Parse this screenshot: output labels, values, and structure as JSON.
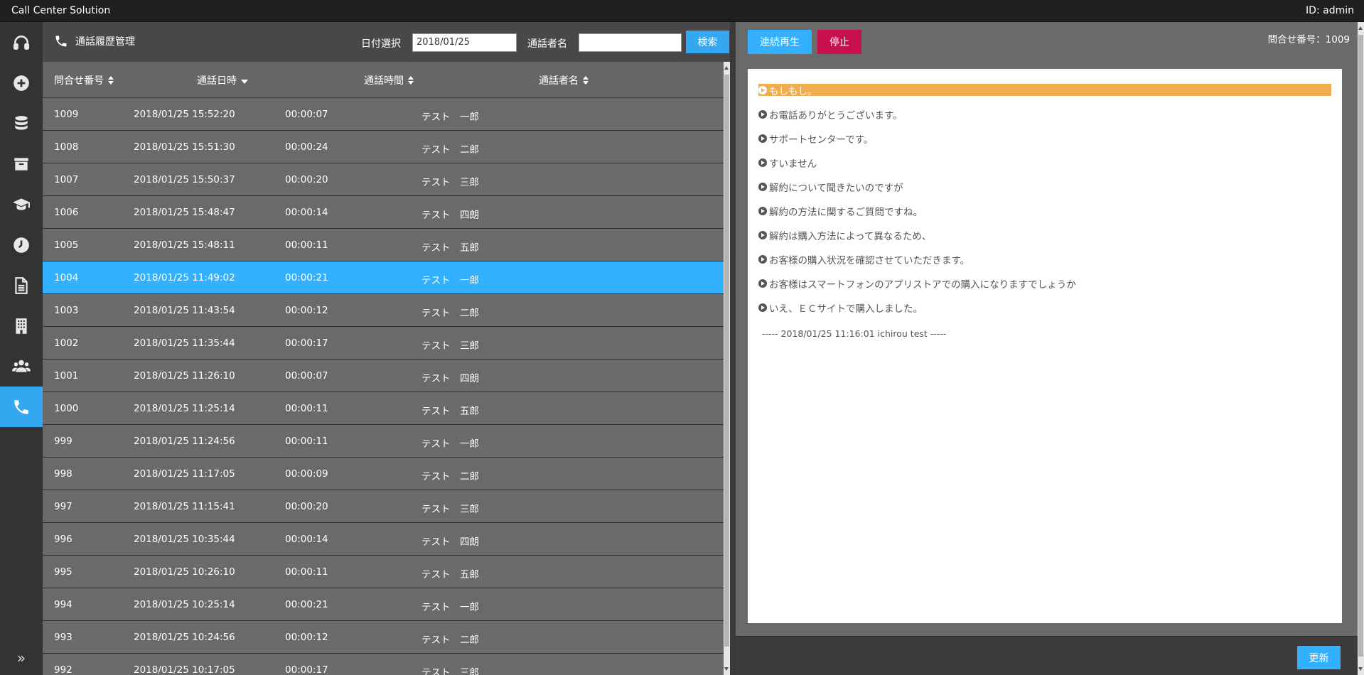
{
  "app": {
    "title": "Call Center Solution",
    "user_id": "ID:  admin"
  },
  "sidebar": {
    "items": [
      {
        "icon": "headset-icon"
      },
      {
        "icon": "plus-circle-icon"
      },
      {
        "icon": "database-icon"
      },
      {
        "icon": "archive-icon"
      },
      {
        "icon": "graduation-cap-icon"
      },
      {
        "icon": "clock-icon"
      },
      {
        "icon": "document-icon"
      },
      {
        "icon": "building-icon"
      },
      {
        "icon": "users-icon"
      },
      {
        "icon": "phone-icon",
        "active": true
      }
    ],
    "expand_icon": "»"
  },
  "call_history": {
    "title": "通話履歴管理",
    "date_label": "日付選択",
    "date_value": "2018/01/25",
    "caller_label": "通話者名",
    "caller_value": "",
    "search_label": "検索",
    "columns": {
      "inquiry_no": "問合せ番号",
      "call_datetime": "通話日時",
      "duration": "通話時間",
      "caller_name": "通話者名"
    },
    "rows": [
      {
        "id": "1009",
        "datetime": "2018/01/25 15:52:20",
        "duration": "00:00:07",
        "name": "テスト　一郎"
      },
      {
        "id": "1008",
        "datetime": "2018/01/25 15:51:30",
        "duration": "00:00:24",
        "name": "テスト　二郎"
      },
      {
        "id": "1007",
        "datetime": "2018/01/25 15:50:37",
        "duration": "00:00:20",
        "name": "テスト　三郎"
      },
      {
        "id": "1006",
        "datetime": "2018/01/25 15:48:47",
        "duration": "00:00:14",
        "name": "テスト　四朗"
      },
      {
        "id": "1005",
        "datetime": "2018/01/25 15:48:11",
        "duration": "00:00:11",
        "name": "テスト　五郎"
      },
      {
        "id": "1004",
        "datetime": "2018/01/25 11:49:02",
        "duration": "00:00:21",
        "name": "テスト　一郎",
        "selected": true
      },
      {
        "id": "1003",
        "datetime": "2018/01/25 11:43:54",
        "duration": "00:00:12",
        "name": "テスト　二郎"
      },
      {
        "id": "1002",
        "datetime": "2018/01/25 11:35:44",
        "duration": "00:00:17",
        "name": "テスト　三郎"
      },
      {
        "id": "1001",
        "datetime": "2018/01/25 11:26:10",
        "duration": "00:00:07",
        "name": "テスト　四朗"
      },
      {
        "id": "1000",
        "datetime": "2018/01/25 11:25:14",
        "duration": "00:00:11",
        "name": "テスト　五郎"
      },
      {
        "id": "999",
        "datetime": "2018/01/25 11:24:56",
        "duration": "00:00:11",
        "name": "テスト　一郎"
      },
      {
        "id": "998",
        "datetime": "2018/01/25 11:17:05",
        "duration": "00:00:09",
        "name": "テスト　二郎"
      },
      {
        "id": "997",
        "datetime": "2018/01/25 11:15:41",
        "duration": "00:00:20",
        "name": "テスト　三郎"
      },
      {
        "id": "996",
        "datetime": "2018/01/25 10:35:44",
        "duration": "00:00:14",
        "name": "テスト　四朗"
      },
      {
        "id": "995",
        "datetime": "2018/01/25 10:26:10",
        "duration": "00:00:11",
        "name": "テスト　五郎"
      },
      {
        "id": "994",
        "datetime": "2018/01/25 10:25:14",
        "duration": "00:00:21",
        "name": "テスト　一郎"
      },
      {
        "id": "993",
        "datetime": "2018/01/25 10:24:56",
        "duration": "00:00:12",
        "name": "テスト　二郎"
      },
      {
        "id": "992",
        "datetime": "2018/01/25 10:17:05",
        "duration": "00:00:17",
        "name": "テスト　三郎"
      }
    ]
  },
  "player": {
    "play_label": "連続再生",
    "stop_label": "停止",
    "inquiry_no": "問合せ番号：1009",
    "lines": [
      {
        "text": "もしもし。",
        "highlight": true
      },
      {
        "text": "お電話ありがとうございます。"
      },
      {
        "text": "サポートセンターです。"
      },
      {
        "text": "すいません"
      },
      {
        "text": "解約について聞きたいのですが"
      },
      {
        "text": "解約の方法に関するご質問ですね。"
      },
      {
        "text": "解約は購入方法によって異なるため、"
      },
      {
        "text": "お客様の購入状況を確認させていただきます。"
      },
      {
        "text": "お客様はスマートフォンのアプリストアでの購入になりますでしょうか"
      },
      {
        "text": "いえ、ＥＣサイトで購入しました。"
      }
    ],
    "separator": "----- 2018/01/25 11:16:01 ichirou test -----",
    "update_label": "更新"
  },
  "colors": {
    "accent": "#33b0ff",
    "stop": "#c8104e",
    "highlight": "#f0ad4e"
  }
}
